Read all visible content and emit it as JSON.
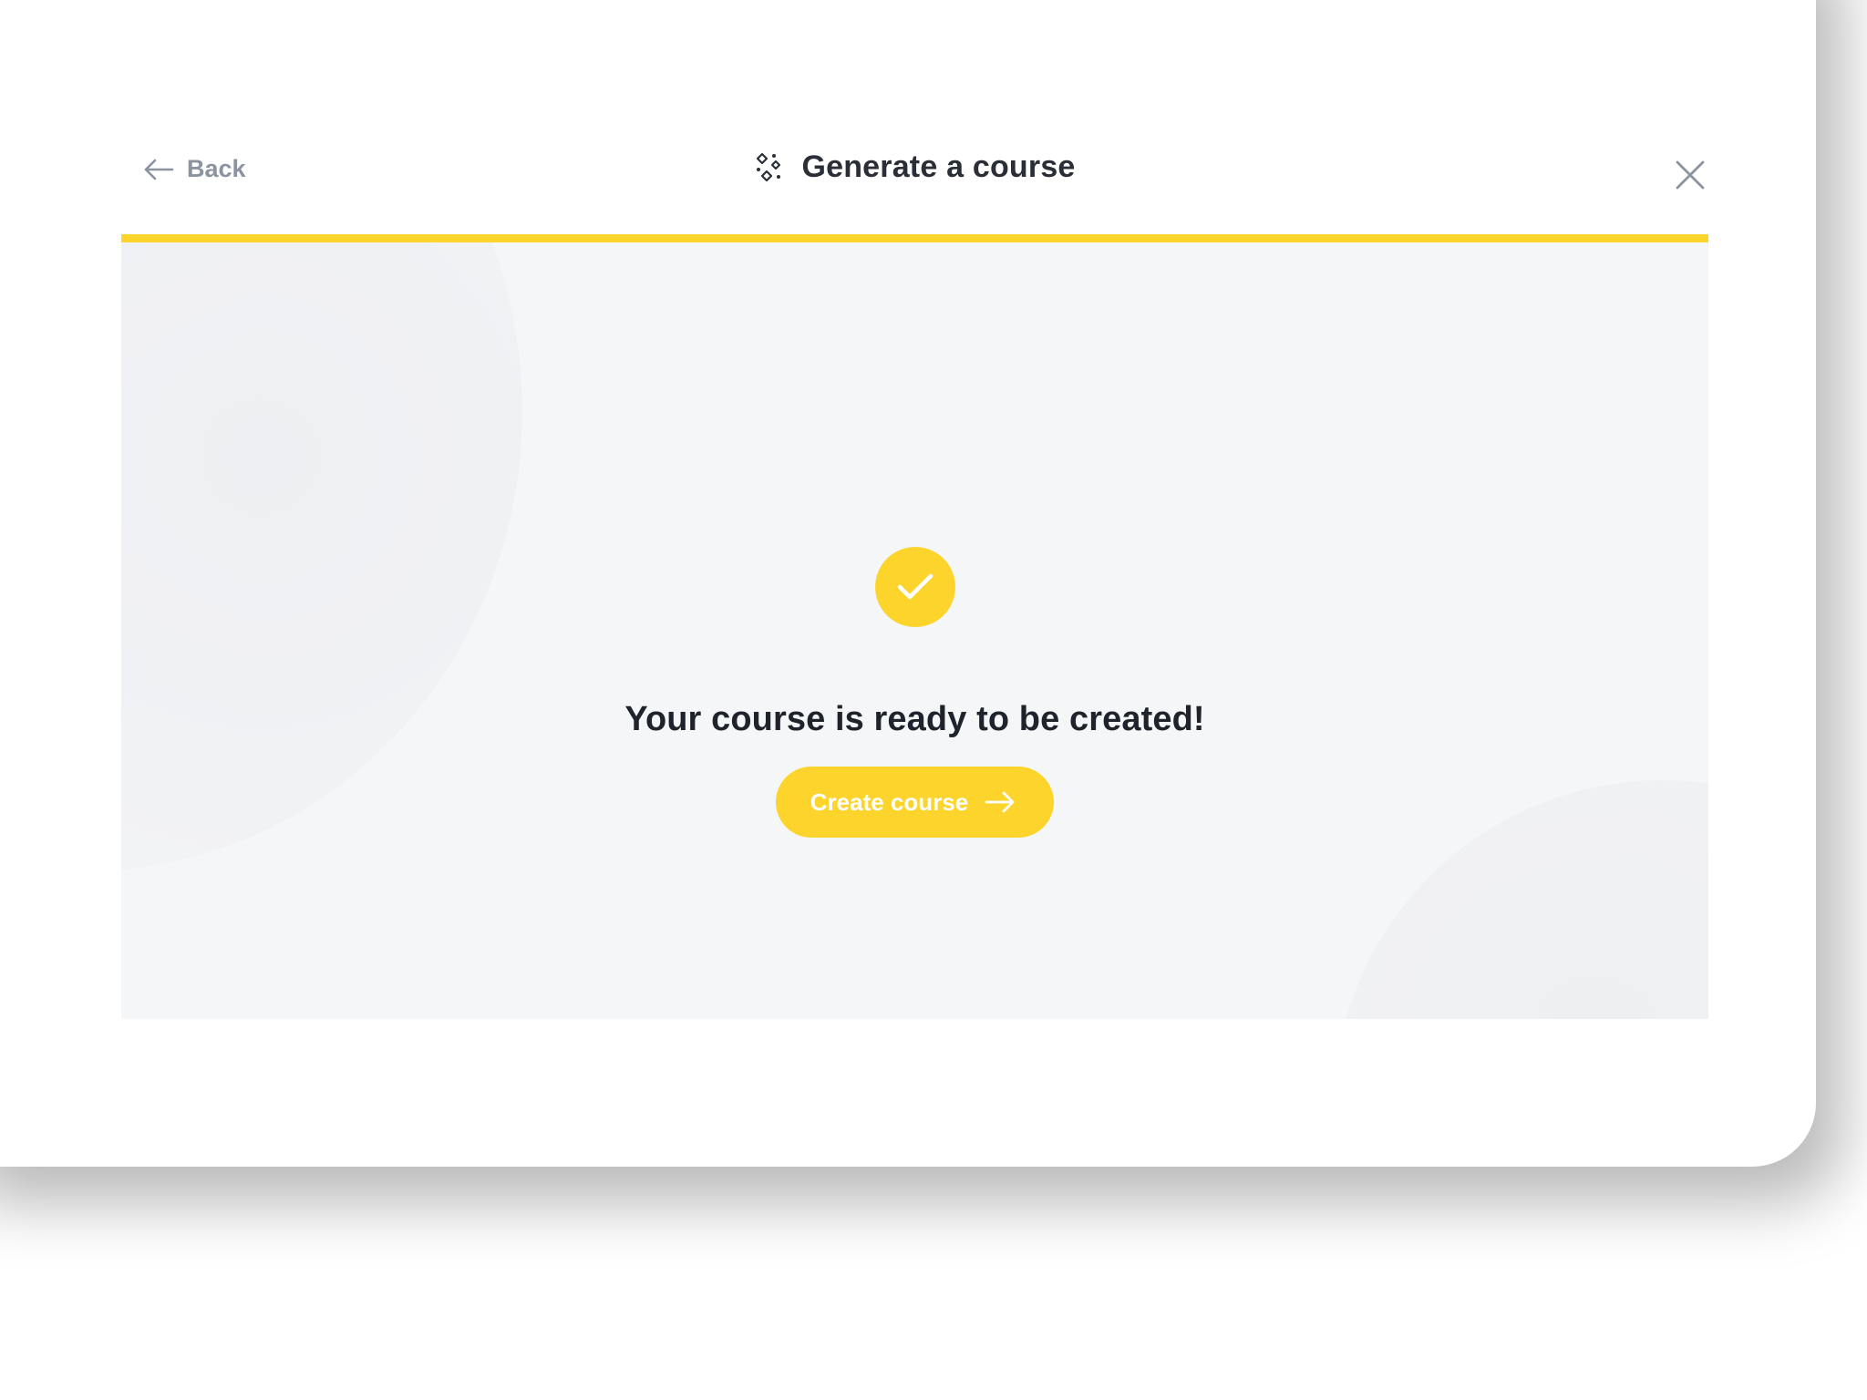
{
  "header": {
    "back_label": "Back",
    "title": "Generate a course",
    "title_icon": "sparkle-diamonds-icon",
    "close_icon": "close-icon"
  },
  "progress": {
    "value_percent": 100
  },
  "main": {
    "status_icon": "check-icon",
    "message": "Your course is ready to be created!",
    "cta_label": "Create course",
    "cta_icon": "arrow-right-icon"
  },
  "colors": {
    "accent": "#fcd42c",
    "panel_background": "#f5f6f8",
    "title_text": "#2a2e36",
    "muted_text": "#8b93a1"
  }
}
